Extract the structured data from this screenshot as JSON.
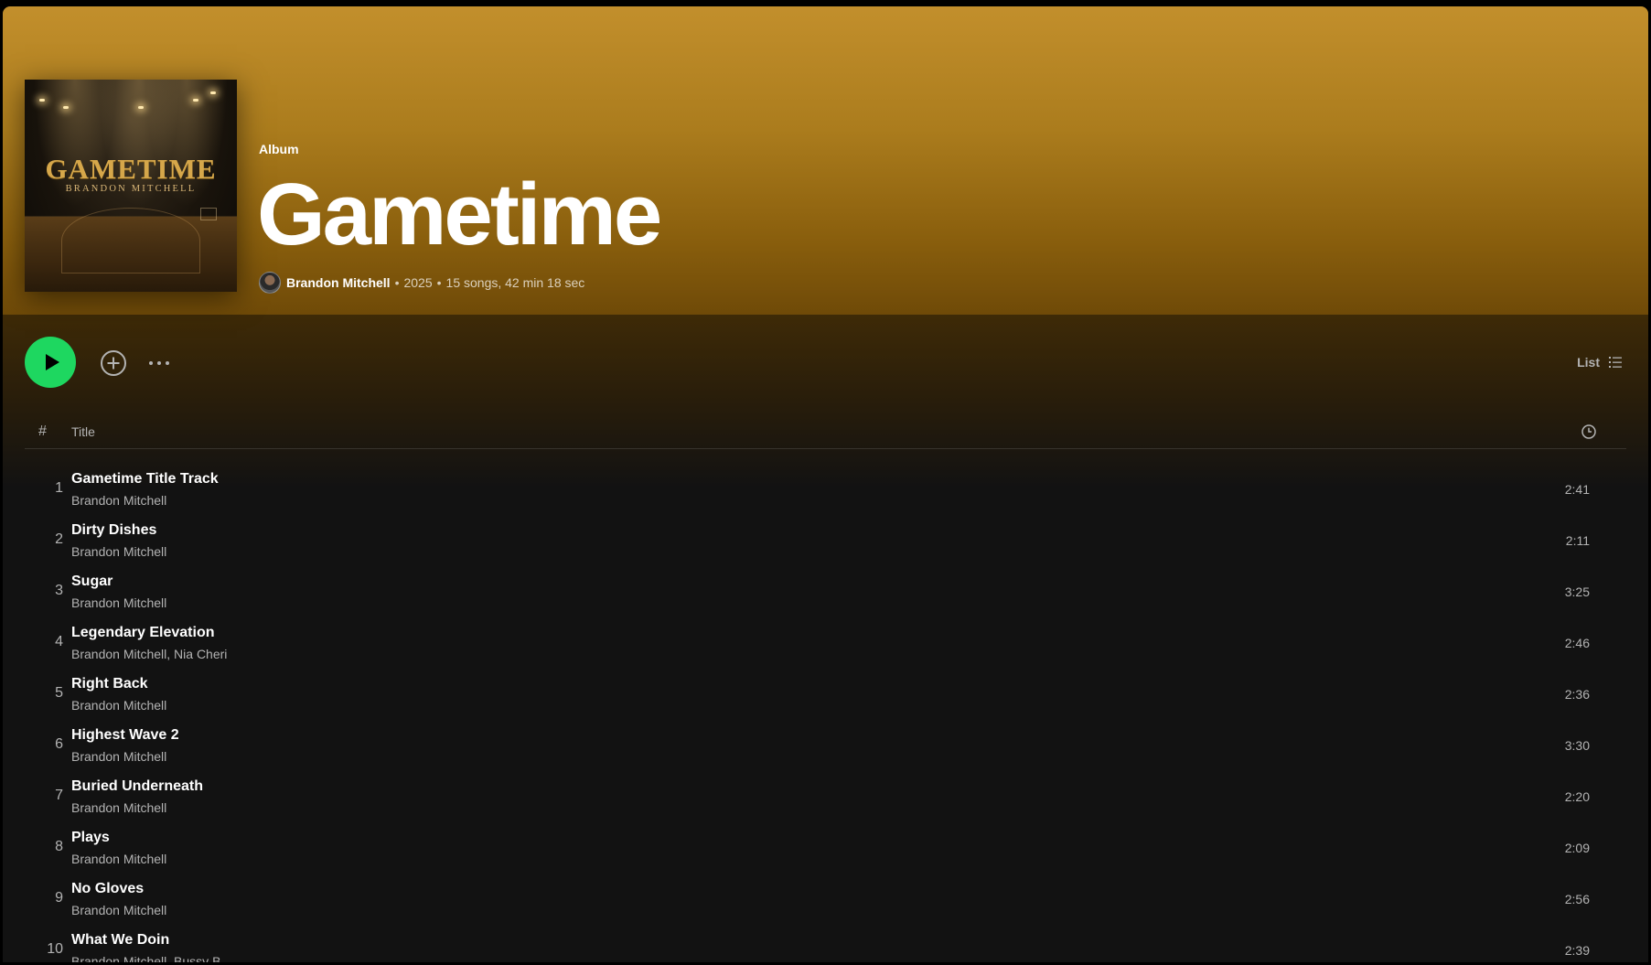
{
  "album": {
    "type_label": "Album",
    "title": "Gametime",
    "artist": "Brandon Mitchell",
    "year": "2025",
    "summary": "15 songs, 42 min 18 sec",
    "cover": {
      "title_text": "GAMETIME",
      "subtitle_text": "BRANDON MITCHELL"
    }
  },
  "colors": {
    "accent": "#1ed760",
    "hero_top": "#c28f2c",
    "background": "#121212"
  },
  "actions": {
    "play_icon": "play-icon",
    "add_icon": "add-circle-icon",
    "more_icon": "more-horizontal-icon",
    "view_label": "List",
    "view_icon": "list-icon"
  },
  "table_header": {
    "number": "#",
    "title": "Title",
    "duration_icon": "clock-icon"
  },
  "tracks": [
    {
      "number": "1",
      "title": "Gametime Title Track",
      "artists": "Brandon Mitchell",
      "duration": "2:41"
    },
    {
      "number": "2",
      "title": "Dirty Dishes",
      "artists": "Brandon Mitchell",
      "duration": "2:11"
    },
    {
      "number": "3",
      "title": "Sugar",
      "artists": "Brandon Mitchell",
      "duration": "3:25"
    },
    {
      "number": "4",
      "title": "Legendary Elevation",
      "artists": "Brandon Mitchell, Nia Cheri",
      "duration": "2:46"
    },
    {
      "number": "5",
      "title": "Right Back",
      "artists": "Brandon Mitchell",
      "duration": "2:36"
    },
    {
      "number": "6",
      "title": "Highest Wave 2",
      "artists": "Brandon Mitchell",
      "duration": "3:30"
    },
    {
      "number": "7",
      "title": "Buried Underneath",
      "artists": "Brandon Mitchell",
      "duration": "2:20"
    },
    {
      "number": "8",
      "title": "Plays",
      "artists": "Brandon Mitchell",
      "duration": "2:09"
    },
    {
      "number": "9",
      "title": "No Gloves",
      "artists": "Brandon Mitchell",
      "duration": "2:56"
    },
    {
      "number": "10",
      "title": "What We Doin",
      "artists": "Brandon Mitchell, Bussy B",
      "duration": "2:39"
    }
  ]
}
